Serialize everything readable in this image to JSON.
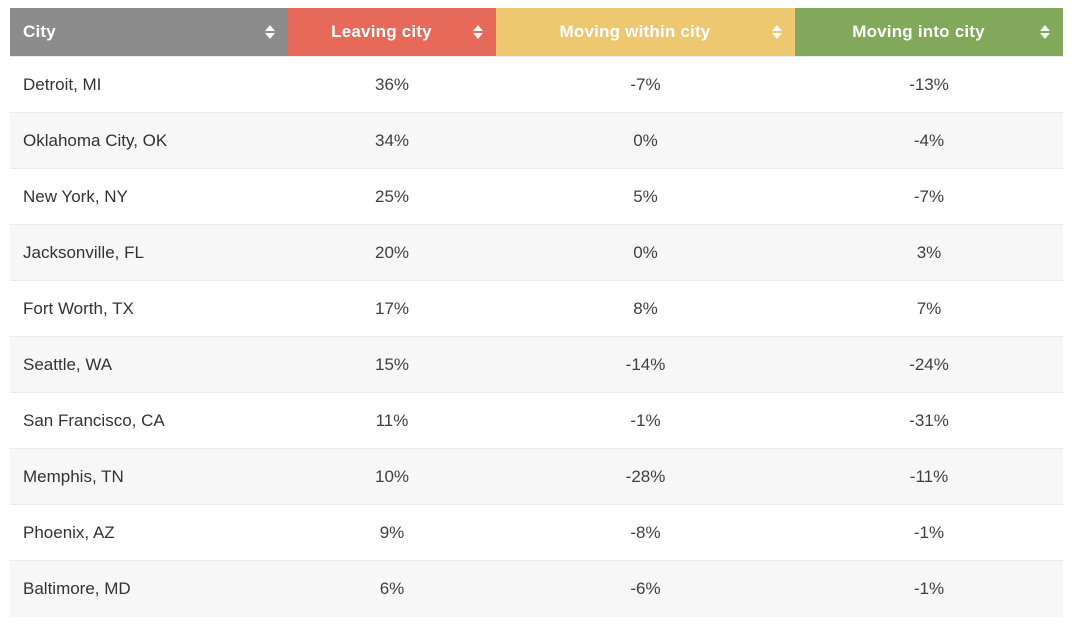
{
  "table": {
    "columns": [
      {
        "key": "city",
        "label": "City",
        "sort_icon": "sort-updown-icon",
        "color": "#8c8c8c",
        "align": "left"
      },
      {
        "key": "leaving",
        "label": "Leaving city",
        "sort_icon": "sort-updown-icon",
        "color": "#e7695a",
        "align": "center"
      },
      {
        "key": "within",
        "label": "Moving within city",
        "sort_icon": "sort-updown-icon",
        "color": "#edc871",
        "align": "center"
      },
      {
        "key": "into",
        "label": "Moving into city",
        "sort_icon": "sort-updown-icon",
        "color": "#82a85b",
        "align": "center"
      }
    ],
    "rows": [
      {
        "city": "Detroit, MI",
        "leaving": "36%",
        "within": "-7%",
        "into": "-13%"
      },
      {
        "city": "Oklahoma City, OK",
        "leaving": "34%",
        "within": "0%",
        "into": "-4%"
      },
      {
        "city": "New York, NY",
        "leaving": "25%",
        "within": "5%",
        "into": "-7%"
      },
      {
        "city": "Jacksonville, FL",
        "leaving": "20%",
        "within": "0%",
        "into": "3%"
      },
      {
        "city": "Fort Worth, TX",
        "leaving": "17%",
        "within": "8%",
        "into": "7%"
      },
      {
        "city": "Seattle, WA",
        "leaving": "15%",
        "within": "-14%",
        "into": "-24%"
      },
      {
        "city": "San Francisco, CA",
        "leaving": "11%",
        "within": "-1%",
        "into": "-31%"
      },
      {
        "city": "Memphis, TN",
        "leaving": "10%",
        "within": "-28%",
        "into": "-11%"
      },
      {
        "city": "Phoenix, AZ",
        "leaving": "9%",
        "within": "-8%",
        "into": "-1%"
      },
      {
        "city": "Baltimore, MD",
        "leaving": "6%",
        "within": "-6%",
        "into": "-1%"
      }
    ]
  },
  "chart_data": {
    "type": "table",
    "title": "",
    "columns": [
      "City",
      "Leaving city",
      "Moving within city",
      "Moving into city"
    ],
    "categories": [
      "Detroit, MI",
      "Oklahoma City, OK",
      "New York, NY",
      "Jacksonville, FL",
      "Fort Worth, TX",
      "Seattle, WA",
      "San Francisco, CA",
      "Memphis, TN",
      "Phoenix, AZ",
      "Baltimore, MD"
    ],
    "series": [
      {
        "name": "Leaving city",
        "values": [
          36,
          34,
          25,
          20,
          17,
          15,
          11,
          10,
          9,
          6
        ]
      },
      {
        "name": "Moving within city",
        "values": [
          -7,
          0,
          5,
          0,
          8,
          -14,
          -1,
          -28,
          -8,
          -6
        ]
      },
      {
        "name": "Moving into city",
        "values": [
          -13,
          -4,
          -7,
          3,
          7,
          -24,
          -31,
          -11,
          -1,
          -1
        ]
      }
    ],
    "units": "percent",
    "legend": "header-row"
  }
}
